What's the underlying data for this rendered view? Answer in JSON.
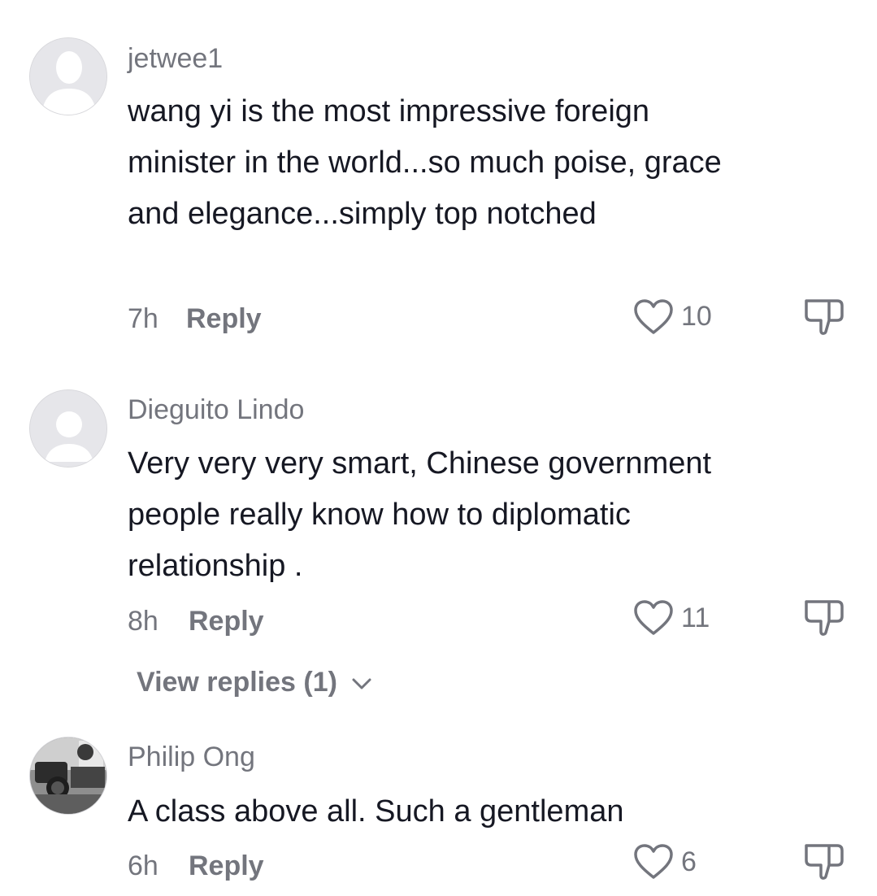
{
  "comments": [
    {
      "username": "jetwee1",
      "text": "wang yi is the most impressive foreign minister in the world...so much poise, grace and elegance...simply top notched",
      "time": "7h",
      "reply_label": "Reply",
      "likes": "10",
      "avatar_icon": "default-avatar-person-icon"
    },
    {
      "username": "Dieguito Lindo",
      "text": "Very very very smart, Chinese government people really know how to diplomatic relationship .",
      "time": "8h",
      "reply_label": "Reply",
      "likes": "11",
      "view_replies": "View replies (1)",
      "avatar_icon": "default-avatar-icon"
    },
    {
      "username": "Philip Ong",
      "text": "A class above all. Such a gentleman",
      "time": "6h",
      "reply_label": "Reply",
      "likes": "6",
      "avatar_icon": "photo-avatar"
    }
  ],
  "icons": {
    "like": "heart-outline-icon",
    "dislike": "thumbs-down-icon",
    "expand": "chevron-down-icon"
  },
  "colors": {
    "text": "#161823",
    "secondary": "#73757d",
    "background": "#ffffff"
  }
}
